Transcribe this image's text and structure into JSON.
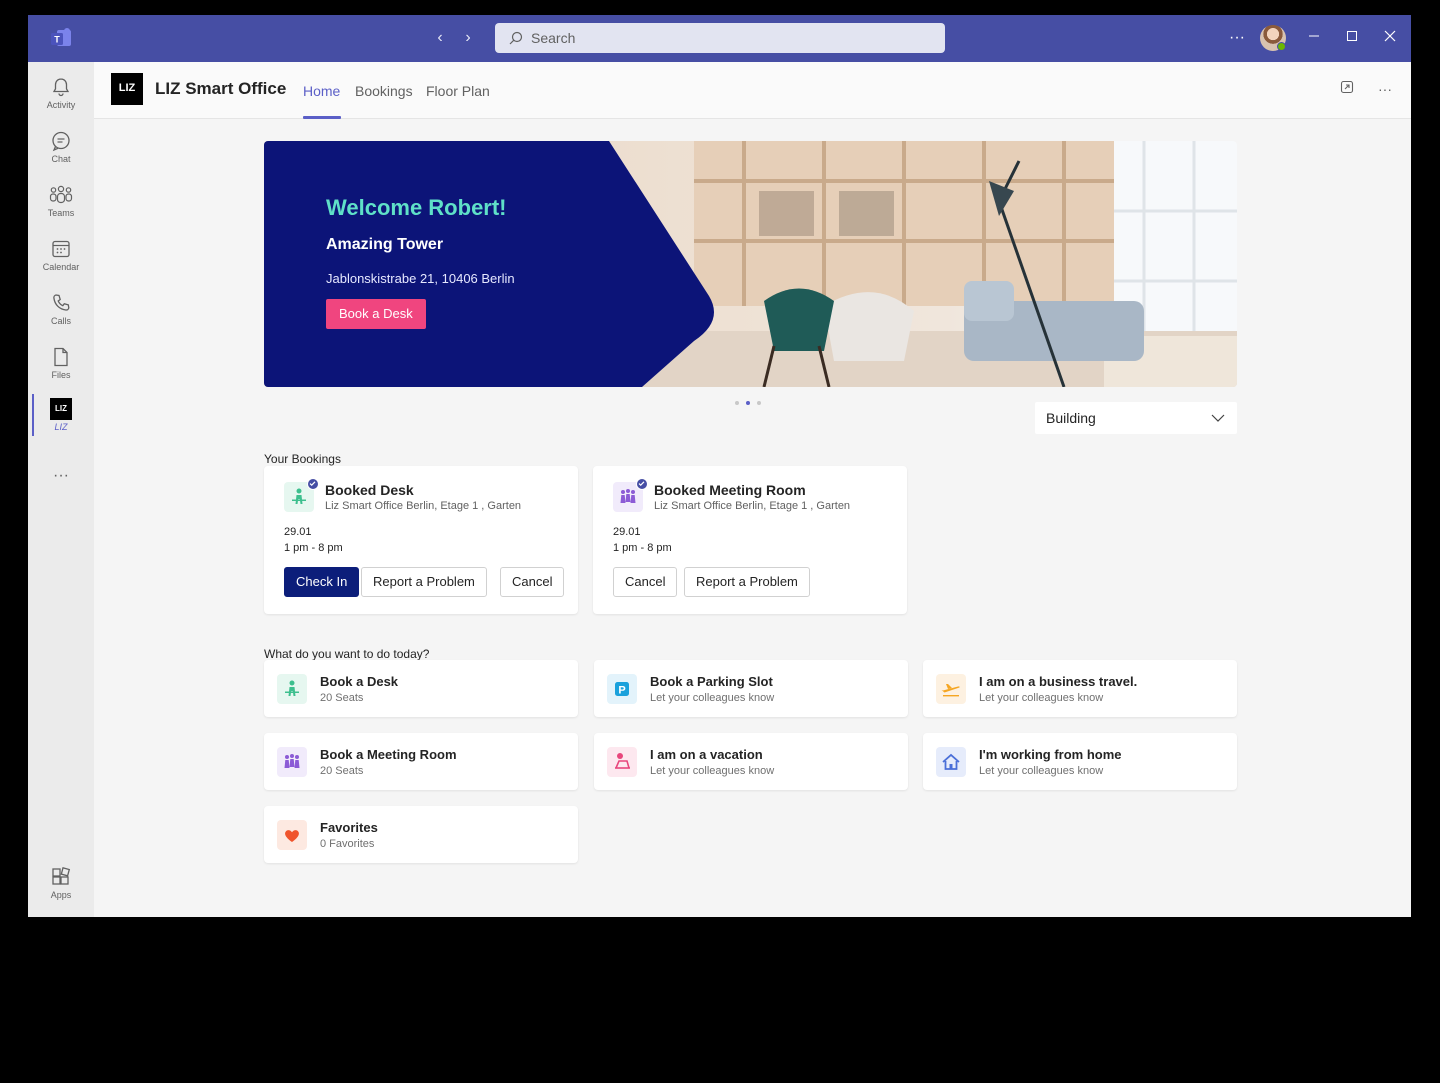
{
  "titlebar": {
    "search_placeholder": "Search",
    "more_label": "···"
  },
  "rail": {
    "items": [
      {
        "label": "Activity"
      },
      {
        "label": "Chat"
      },
      {
        "label": "Teams"
      },
      {
        "label": "Calendar"
      },
      {
        "label": "Calls"
      },
      {
        "label": "Files"
      }
    ],
    "app_logo_text": "LIZ",
    "app_label": "LIZ",
    "more_label": "···",
    "apps_label": "Apps"
  },
  "app": {
    "logo_text": "LIZ",
    "title": "LIZ Smart Office",
    "tabs": [
      {
        "label": "Home",
        "active": true
      },
      {
        "label": "Bookings",
        "active": false
      },
      {
        "label": "Floor Plan",
        "active": false
      }
    ],
    "more_label": "···"
  },
  "hero": {
    "welcome": "Welcome Robert!",
    "building": "Amazing Tower",
    "address": "Jablonskistrabe 21, 10406 Berlin",
    "button_label": "Book  a Desk",
    "panel_color": "#0c1478",
    "welcome_color": "#5fe0c8",
    "button_color": "#f0457f",
    "slide_count": 3,
    "active_slide": 2
  },
  "building_select": {
    "value": "Building"
  },
  "your_bookings": {
    "title": "Your Bookings",
    "cards": [
      {
        "icon": "desk-person-icon",
        "title": "Booked Desk",
        "location": "Liz Smart Office Berlin, Etage 1 , Garten",
        "date": "29.01",
        "time": "1 pm - 8 pm",
        "buttons": [
          "Check In",
          "Report a Problem",
          "Cancel"
        ]
      },
      {
        "icon": "meeting-room-icon",
        "title": "Booked Meeting Room",
        "location": "Liz Smart Office Berlin, Etage 1 , Garten",
        "date": "29.01",
        "time": "1 pm - 8 pm",
        "buttons": [
          "Cancel",
          "Report a Problem"
        ]
      }
    ]
  },
  "actions": {
    "title": "What do you want to do today?",
    "items": [
      {
        "title": "Book a Desk",
        "subtitle": "20 Seats",
        "icon": "desk-person-icon"
      },
      {
        "title": "Book a Parking Slot",
        "subtitle": "Let your colleagues know",
        "icon": "parking-icon"
      },
      {
        "title": "I am on a business travel.",
        "subtitle": "Let your colleagues know",
        "icon": "airplane-icon"
      },
      {
        "title": "Book a Meeting Room",
        "subtitle": "20 Seats",
        "icon": "meeting-room-icon"
      },
      {
        "title": "I am on a vacation",
        "subtitle": "Let your colleagues know",
        "icon": "beach-chair-icon"
      },
      {
        "title": "I'm working from home",
        "subtitle": "Let your colleagues know",
        "icon": "home-icon"
      },
      {
        "title": "Favorites",
        "subtitle": "0 Favorites",
        "icon": "heart-icon"
      }
    ]
  }
}
